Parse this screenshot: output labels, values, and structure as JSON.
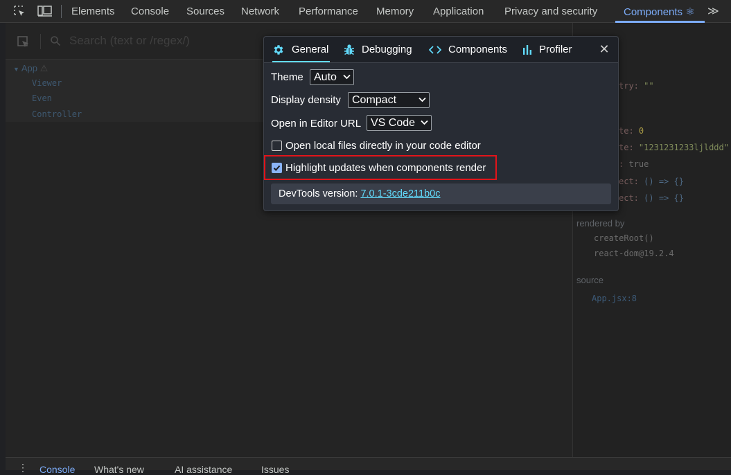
{
  "topbar": {
    "tabs": [
      "Elements",
      "Console",
      "Sources",
      "Network",
      "Performance",
      "Memory",
      "Application",
      "Privacy and security"
    ],
    "active_tab": "Components ⚛",
    "more": "≫"
  },
  "tree": {
    "search_placeholder": "Search (text or /regex/)",
    "root": "App",
    "warning_icon": "⚠",
    "children": [
      "Viewer",
      "Even",
      "Controller"
    ]
  },
  "props": {
    "line1": {
      "key": "try:",
      "value": "\"\""
    },
    "line2": {
      "key": "te:",
      "value": "0"
    },
    "line3": {
      "key": "te:",
      "value": "\"1231231233ljlddd\""
    },
    "line4": {
      "key": ":",
      "value": "true"
    },
    "line5": {
      "key": "ect:",
      "value": "() => {}"
    },
    "line6": {
      "key": "ect:",
      "value": "() => {}"
    },
    "rendered_by_label": "rendered by",
    "rendered_by": [
      "createRoot()",
      "react-dom@19.2.4"
    ],
    "source_label": "source",
    "source": "App.jsx:8"
  },
  "drawer": {
    "tabs": [
      "Console",
      "What's new",
      "AI assistance",
      "Issues"
    ],
    "active_tab": "Console",
    "kebab": "⋮"
  },
  "modal": {
    "tabs": {
      "general": "General",
      "debugging": "Debugging",
      "components": "Components",
      "profiler": "Profiler"
    },
    "close": "✕",
    "theme_label": "Theme",
    "theme_value": "Auto",
    "density_label": "Display density",
    "density_value": "Compact",
    "editor_label": "Open in Editor URL",
    "editor_value": "VS Code",
    "open_local_label": "Open local files directly in your code editor",
    "open_local_checked": false,
    "highlight_label": "Highlight updates when components render",
    "highlight_checked": true,
    "version_label": "DevTools version: ",
    "version_value": "7.0.1-3cde211b0c"
  },
  "colors": {
    "accent": "#61dafb",
    "highlight_frame": "#e2141a",
    "checkbox_checked": "#8ab4f8",
    "chrome_active_tab": "#7cacf8"
  }
}
